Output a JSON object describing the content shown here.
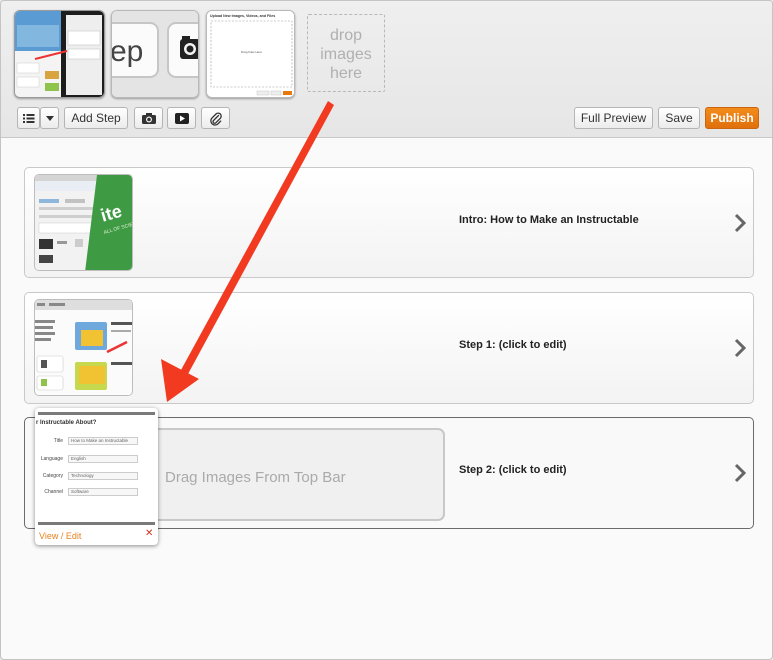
{
  "media_bar": {
    "thumb2_text": "ep",
    "thumb3_heading": "Upload New Images, Videos, and Files",
    "thumb3_drop_text": "Drag Files Here",
    "drop_zone": [
      "drop",
      "images",
      "here"
    ]
  },
  "toolbar": {
    "add_step_label": "Add Step",
    "full_preview_label": "Full Preview",
    "save_label": "Save",
    "publish_label": "Publish"
  },
  "steps": [
    {
      "title": "Intro: How to Make an Instructable"
    },
    {
      "title": "Step 1: (click to edit)"
    },
    {
      "title": "Step 2: (click to edit)",
      "drag_text": "Drag Images From Top Bar"
    }
  ],
  "popup": {
    "heading": "r Instructable About?",
    "fields": [
      {
        "label": "Title",
        "value": "How to Make an Instructable"
      },
      {
        "label": "Language",
        "value": "English"
      },
      {
        "label": "Category",
        "value": "Technology"
      },
      {
        "label": "Channel",
        "value": "Software"
      }
    ],
    "view_edit": "View / Edit",
    "close": "✕"
  },
  "colors": {
    "publish": "#e8790f",
    "arrow": "#f23a21",
    "link": "#e8821f",
    "close": "#d0311e"
  }
}
